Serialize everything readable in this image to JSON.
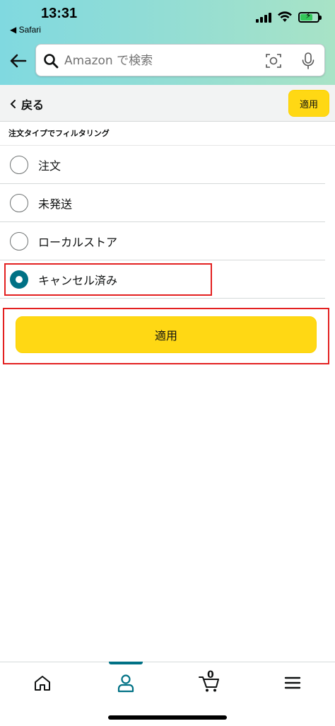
{
  "status_bar": {
    "time": "13:31",
    "back_app": "◀ Safari"
  },
  "search": {
    "placeholder": "Amazon で検索"
  },
  "subbar": {
    "back_label": "戻る",
    "apply_label": "適用"
  },
  "filter": {
    "section_title": "注文タイプでフィルタリング",
    "options": [
      {
        "label": "注文",
        "checked": false
      },
      {
        "label": "未発送",
        "checked": false
      },
      {
        "label": "ローカルストア",
        "checked": false
      },
      {
        "label": "キャンセル済み",
        "checked": true
      }
    ],
    "apply_button": "適用"
  },
  "bottom_nav": {
    "items": [
      "home-icon",
      "account-icon",
      "cart-icon",
      "menu-icon"
    ],
    "cart_count": "0",
    "active_item": "account-icon"
  },
  "colors": {
    "accent": "#007185",
    "button_yellow": "#FFD814",
    "highlight_red": "#E32020"
  }
}
